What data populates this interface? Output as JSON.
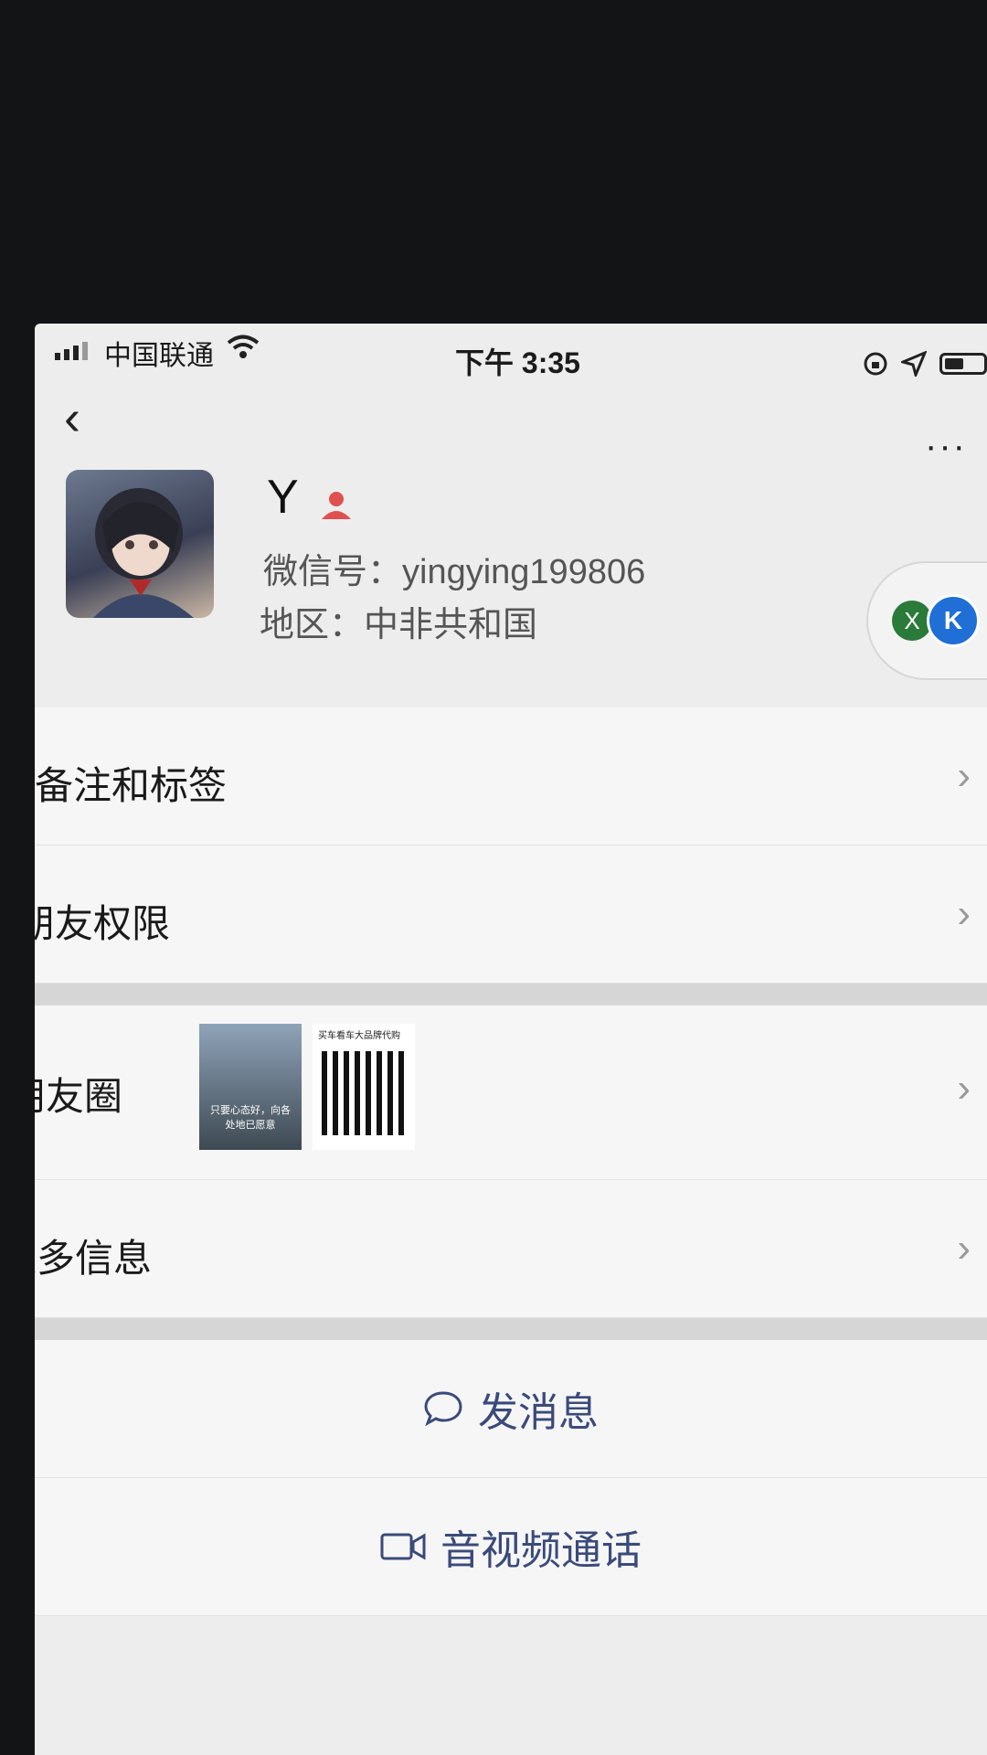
{
  "status_bar": {
    "carrier": "中国联通",
    "time": "下午 3:35"
  },
  "nav": {
    "back_icon": "chevron-left-icon",
    "more_label": "···"
  },
  "profile": {
    "name": "Y",
    "wechat_id": "微信号：yingying199806",
    "region": "地区：中非共和国"
  },
  "float_widget": {
    "x_label": "X",
    "k_label": "K"
  },
  "rows": {
    "remark": "备注和标签",
    "permissions": "朋友权限",
    "moments": "朋友圈",
    "more_info": "更多信息"
  },
  "moments_thumbs": {
    "photo_caption": "只要心态好，向各处地已愿意",
    "qr_header": "买车看车大品牌代购"
  },
  "actions": {
    "message": "发消息",
    "video_call": "音视频通话"
  },
  "colors": {
    "action_text": "#3a4a7a",
    "badge": "#e05050"
  }
}
